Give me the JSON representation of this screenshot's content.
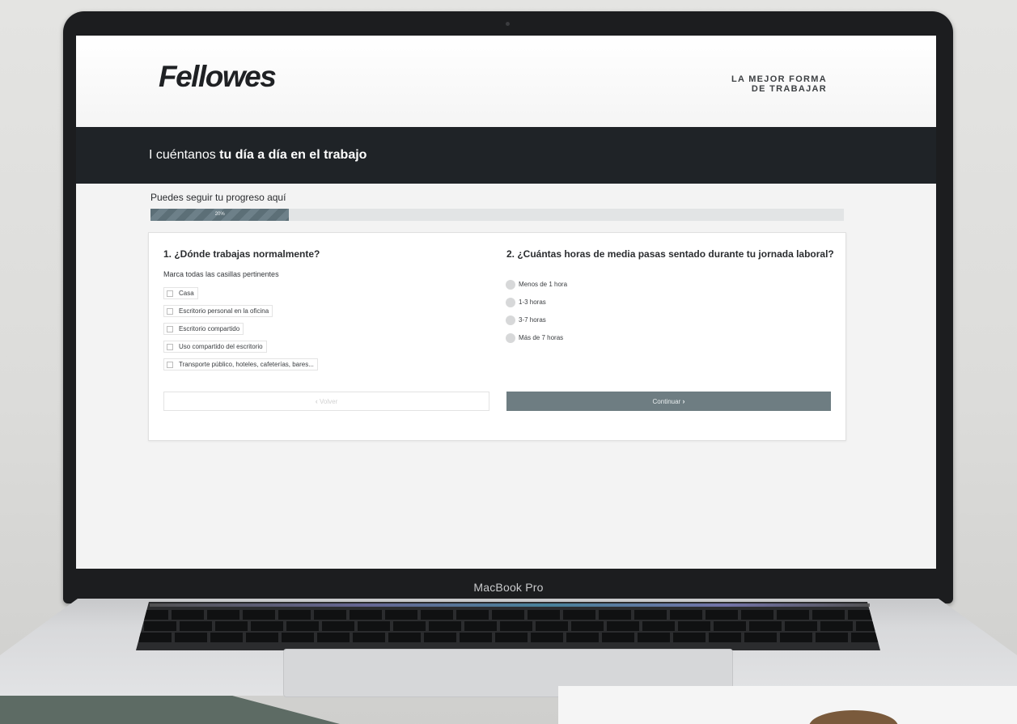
{
  "device": {
    "label": "MacBook Pro"
  },
  "header": {
    "logo_text": "Fellowes",
    "tagline_line1": "LA MEJOR FORMA",
    "tagline_line2": "DE TRABAJAR"
  },
  "title_bar": {
    "prefix": "I cuéntanos ",
    "emphasis": "tu día a día en el trabajo"
  },
  "progress": {
    "label": "Puedes seguir tu progreso aquí",
    "percent_text": "20%",
    "fraction": 0.2
  },
  "question1": {
    "title": "1. ¿Dónde trabajas normalmente?",
    "hint": "Marca todas las casillas pertinentes",
    "options": [
      "Casa",
      "Escritorio personal en la oficina",
      "Escritorio compartido",
      "Uso compartido del escritorio",
      "Transporte público, hoteles, cafeterías, bares..."
    ]
  },
  "question2": {
    "title": "2. ¿Cuántas horas de media pasas sentado durante tu jornada laboral?",
    "options": [
      "Menos de 1 hora",
      "1-3 horas",
      "3-7 horas",
      "Más de 7 horas"
    ]
  },
  "navigation": {
    "back_label": "Volver",
    "back_chevron": "‹",
    "continue_label": "Continuar",
    "continue_chevron": "›"
  },
  "colors": {
    "title_bar": "#1f2327",
    "progress_fill": "#5c6f77",
    "continue_button": "#6e7d82",
    "accent_green": "#5d6b64"
  }
}
